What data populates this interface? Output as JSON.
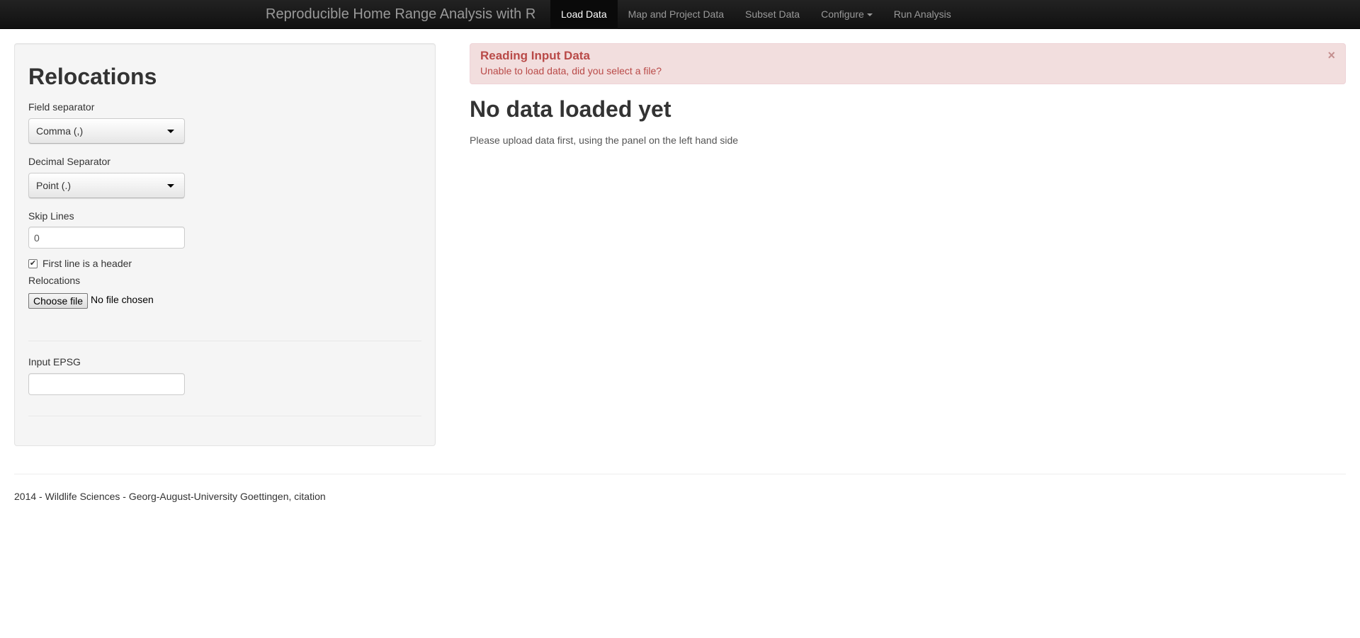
{
  "navbar": {
    "brand": "Reproducible Home Range Analysis with R",
    "items": [
      {
        "label": "Load Data",
        "active": true
      },
      {
        "label": "Map and Project Data",
        "active": false
      },
      {
        "label": "Subset Data",
        "active": false
      },
      {
        "label": "Configure",
        "active": false,
        "dropdown": true
      },
      {
        "label": "Run Analysis",
        "active": false
      }
    ]
  },
  "sidebar": {
    "title": "Relocations",
    "field_separator": {
      "label": "Field separator",
      "value": "Comma (,)"
    },
    "decimal_separator": {
      "label": "Decimal Separator",
      "value": "Point (.)"
    },
    "skip_lines": {
      "label": "Skip Lines",
      "value": "0"
    },
    "header_checkbox": {
      "label": "First line is a header",
      "checked": true,
      "mark": "✔"
    },
    "file_input": {
      "label": "Relocations",
      "button": "Choose file",
      "status": "No file chosen"
    },
    "epsg": {
      "label": "Input EPSG",
      "value": ""
    }
  },
  "alert": {
    "title": "Reading Input Data",
    "message": "Unable to load data, did you select a file?",
    "close": "×",
    "bg_color": "#f2dede",
    "text_color": "#b94a48"
  },
  "main": {
    "heading": "No data loaded yet",
    "text": "Please upload data first, using the panel on the left hand side"
  },
  "footer": {
    "text": "2014 - Wildlife Sciences - Georg-August-University Goettingen, ",
    "link": "citation"
  }
}
